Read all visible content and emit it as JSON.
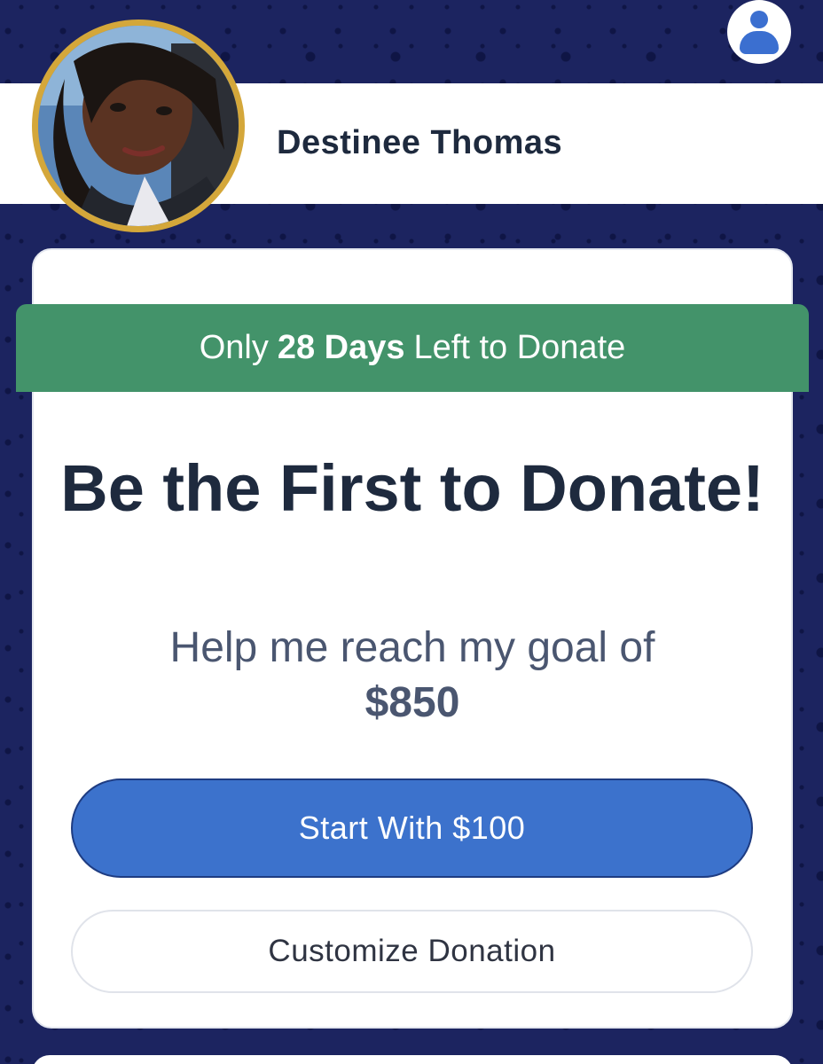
{
  "header": {
    "profile_icon": "user-account-icon",
    "name": "Destinee Thomas"
  },
  "campaign": {
    "days_left": {
      "prefix": "Only",
      "emphasis": "28 Days",
      "suffix": "Left to Donate"
    },
    "headline": "Be the First to Donate!",
    "subline": "Help me reach my goal of",
    "goal_amount": "$850"
  },
  "actions": {
    "primary_label": "Start With $100",
    "secondary_label": "Customize Donation"
  },
  "colors": {
    "background": "#1c2460",
    "banner": "#43936a",
    "primary_button": "#3c72cc",
    "avatar_ring": "#d4a73a",
    "heading_text": "#1e2a3e"
  }
}
